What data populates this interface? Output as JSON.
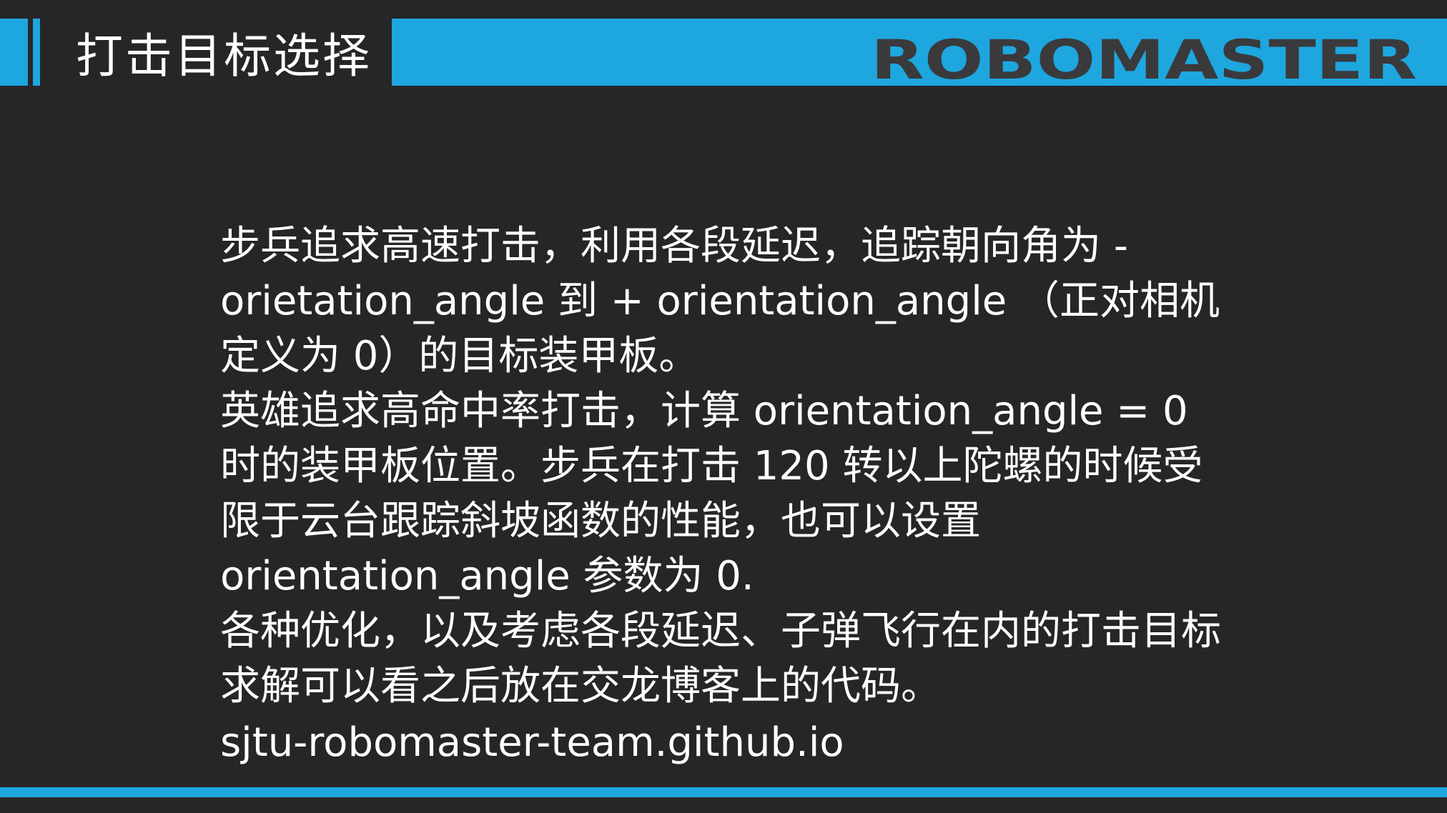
{
  "header": {
    "title": "打击目标选择",
    "logo_text": "ROBOMASTER"
  },
  "content": {
    "paragraphs": [
      "步兵追求高速打击，利用各段延迟，追踪朝向角为 -orietation_angle 到 + orientation_angle （正对相机定义为 0）的目标装甲板。",
      "英雄追求高命中率打击，计算 orientation_angle = 0 时的装甲板位置。步兵在打击 120 转以上陀螺的时候受限于云台跟踪斜坡函数的性能，也可以设置 orientation_angle 参数为 0.",
      "各种优化，以及考虑各段延迟、子弹飞行在内的打击目标求解可以看之后放在交龙博客上的代码。"
    ],
    "url": "sjtu-robomaster-team.github.io"
  },
  "colors": {
    "accent": "#1ea6df",
    "background": "#262627",
    "logo": "#3a3a3c",
    "text": "#ffffff"
  }
}
